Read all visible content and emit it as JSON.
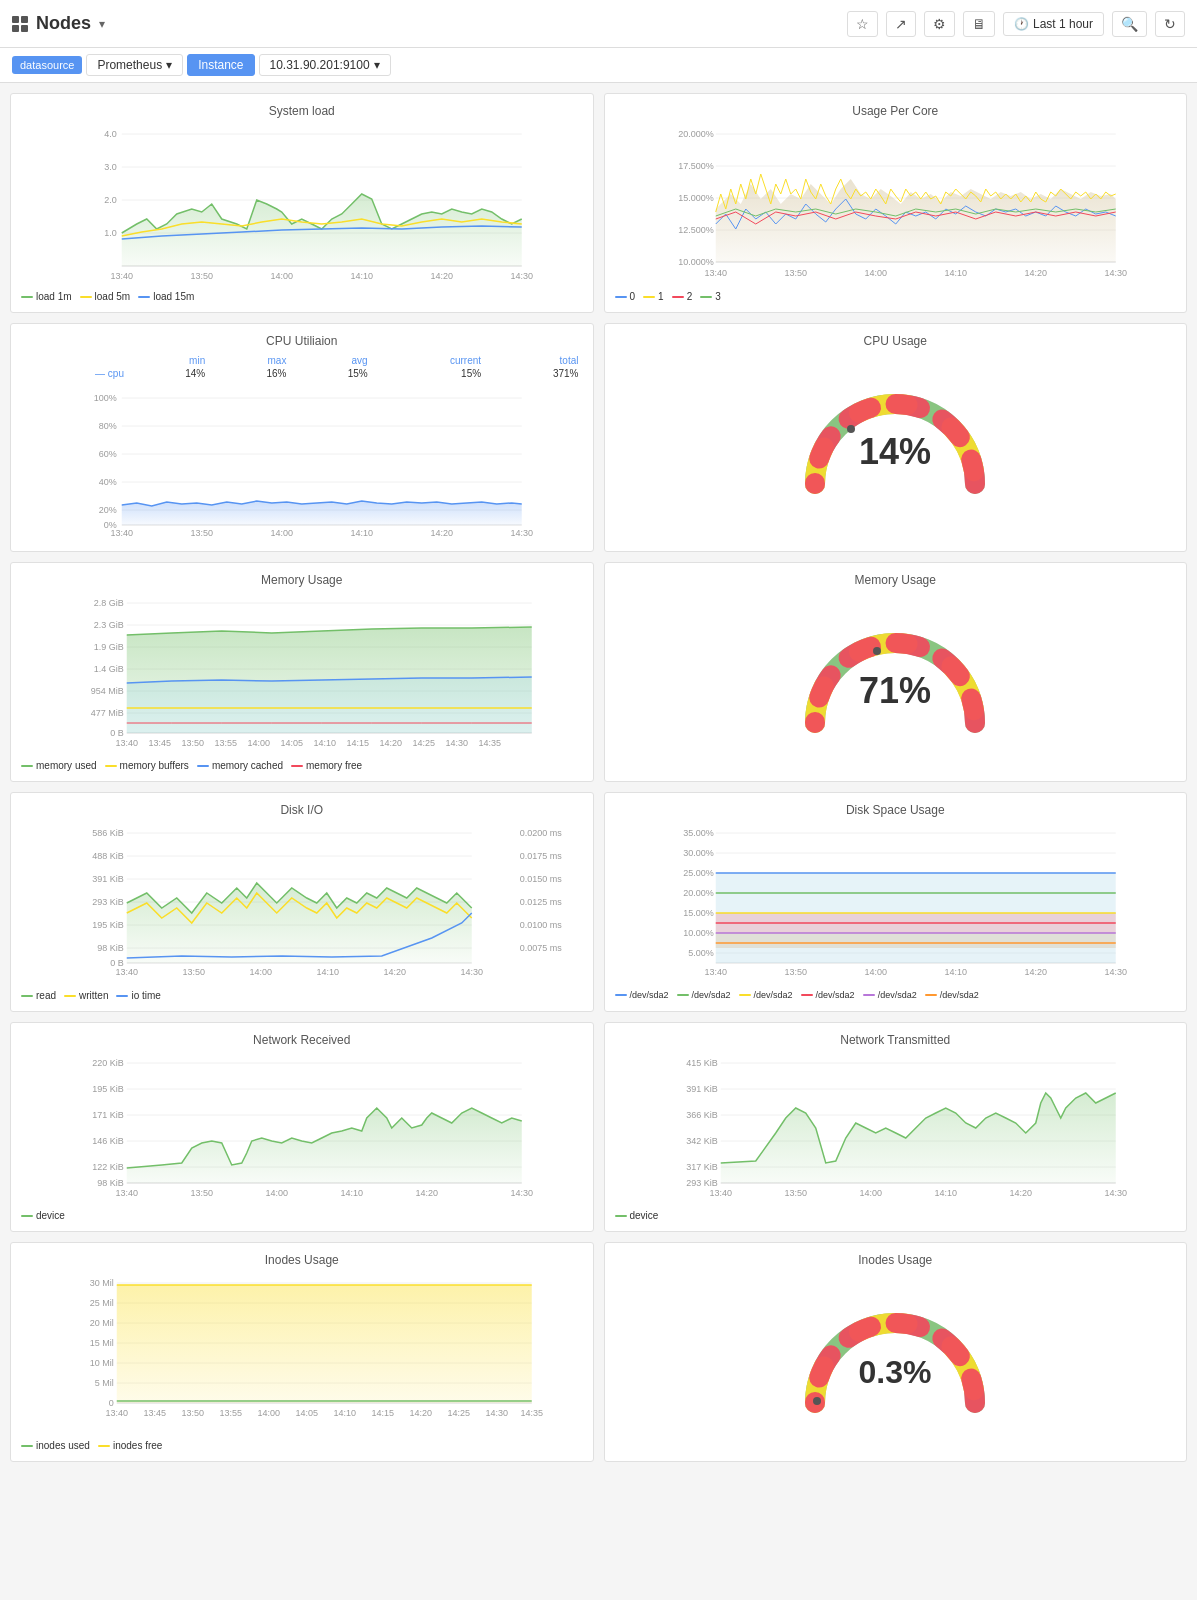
{
  "topbar": {
    "title": "Nodes",
    "time_label": "Last 1 hour",
    "icons": [
      "star",
      "share",
      "settings",
      "monitor",
      "clock",
      "search",
      "refresh"
    ]
  },
  "navbar": {
    "datasource": "datasource",
    "prometheus": "Prometheus",
    "instance_label": "Instance",
    "instance_value": "10.31.90.201:9100"
  },
  "panels": {
    "system_load": {
      "title": "System load",
      "y_labels": [
        "4.0",
        "3.0",
        "2.0",
        "1.0"
      ],
      "x_labels": [
        "13:40",
        "13:50",
        "14:00",
        "14:10",
        "14:20",
        "14:30"
      ],
      "legend": [
        {
          "label": "load 1m",
          "color": "#73BF69"
        },
        {
          "label": "load 5m",
          "color": "#FADE2A"
        },
        {
          "label": "load 15m",
          "color": "#5794F2"
        }
      ]
    },
    "usage_per_core": {
      "title": "Usage Per Core",
      "y_labels": [
        "20.000%",
        "17.500%",
        "15.000%",
        "12.500%",
        "10.000%"
      ],
      "x_labels": [
        "13:40",
        "13:50",
        "14:00",
        "14:10",
        "14:20",
        "14:30"
      ],
      "legend": [
        {
          "label": "0",
          "color": "#5794F2"
        },
        {
          "label": "1",
          "color": "#FADE2A"
        },
        {
          "label": "2",
          "color": "#F2495C"
        },
        {
          "label": "3",
          "color": "#73BF69"
        }
      ]
    },
    "cpu_utilization": {
      "title": "CPU Utiliaion",
      "y_labels": [
        "100%",
        "80%",
        "60%",
        "40%",
        "20%",
        "0%"
      ],
      "x_labels": [
        "13:40",
        "13:50",
        "14:00",
        "14:10",
        "14:20",
        "14:30"
      ],
      "table": {
        "headers": [
          "",
          "min",
          "max",
          "avg",
          "current",
          "total"
        ],
        "rows": [
          {
            "name": "cpu",
            "color": "#5794F2",
            "min": "14%",
            "max": "16%",
            "avg": "15%",
            "current": "15%",
            "total": "371%"
          }
        ]
      }
    },
    "cpu_usage_gauge": {
      "title": "CPU Usage",
      "value": "14%",
      "percentage": 14,
      "color": "#73BF69"
    },
    "memory_usage_chart": {
      "title": "Memory Usage",
      "y_labels": [
        "2.8 GiB",
        "2.3 GiB",
        "1.9 GiB",
        "1.4 GiB",
        "954 MiB",
        "477 MiB",
        "0 B"
      ],
      "x_labels": [
        "13:40",
        "13:45",
        "13:50",
        "13:55",
        "14:00",
        "14:05",
        "14:10",
        "14:15",
        "14:20",
        "14:25",
        "14:30",
        "14:35"
      ],
      "legend": [
        {
          "label": "memory used",
          "color": "#73BF69"
        },
        {
          "label": "memory buffers",
          "color": "#FADE2A"
        },
        {
          "label": "memory cached",
          "color": "#5794F2"
        },
        {
          "label": "memory free",
          "color": "#F2495C"
        }
      ]
    },
    "memory_usage_gauge": {
      "title": "Memory Usage",
      "value": "71%",
      "percentage": 71,
      "color": "#73BF69"
    },
    "disk_io": {
      "title": "Disk I/O",
      "y_labels_left": [
        "586 KiB",
        "488 KiB",
        "391 KiB",
        "293 KiB",
        "195 KiB",
        "98 KiB",
        "0 B"
      ],
      "y_labels_right": [
        "0.0200 ms",
        "0.0175 ms",
        "0.0150 ms",
        "0.0125 ms",
        "0.0100 ms",
        "0.0075 ms"
      ],
      "x_labels": [
        "13:40",
        "13:50",
        "14:00",
        "14:10",
        "14:20",
        "14:30"
      ],
      "legend": [
        {
          "label": "read",
          "color": "#73BF69"
        },
        {
          "label": "written",
          "color": "#FADE2A"
        },
        {
          "label": "io time",
          "color": "#5794F2"
        }
      ]
    },
    "disk_space": {
      "title": "Disk Space Usage",
      "y_labels": [
        "35.00%",
        "30.00%",
        "25.00%",
        "20.00%",
        "15.00%",
        "10.00%",
        "5.00%"
      ],
      "x_labels": [
        "13:40",
        "13:50",
        "14:00",
        "14:10",
        "14:20",
        "14:30"
      ],
      "legend": [
        {
          "label": "/dev/sda2",
          "color": "#5794F2"
        },
        {
          "label": "/dev/sda2",
          "color": "#73BF69"
        },
        {
          "label": "/dev/sda2",
          "color": "#FADE2A"
        },
        {
          "label": "/dev/sda2",
          "color": "#F2495C"
        },
        {
          "label": "/dev/sda2",
          "color": "#B877D9"
        },
        {
          "label": "/dev/sda2",
          "color": "#FF9830"
        }
      ]
    },
    "network_received": {
      "title": "Network Received",
      "y_labels": [
        "220 KiB",
        "195 KiB",
        "171 KiB",
        "146 KiB",
        "122 KiB",
        "98 KiB"
      ],
      "x_labels": [
        "13:40",
        "13:50",
        "14:00",
        "14:10",
        "14:20",
        "14:30"
      ],
      "legend": [
        {
          "label": "device",
          "color": "#73BF69"
        }
      ]
    },
    "network_transmitted": {
      "title": "Network Transmitted",
      "y_labels": [
        "415 KiB",
        "391 KiB",
        "366 KiB",
        "342 KiB",
        "317 KiB",
        "293 KiB"
      ],
      "x_labels": [
        "13:40",
        "13:50",
        "14:00",
        "14:10",
        "14:20",
        "14:30"
      ],
      "legend": [
        {
          "label": "device",
          "color": "#73BF69"
        }
      ]
    },
    "inodes_usage_chart": {
      "title": "Inodes Usage",
      "y_labels": [
        "30 Mil",
        "25 Mil",
        "20 Mil",
        "15 Mil",
        "10 Mil",
        "5 Mil",
        "0"
      ],
      "x_labels": [
        "13:40",
        "13:45",
        "13:50",
        "13:55",
        "14:00",
        "14:05",
        "14:10",
        "14:15",
        "14:20",
        "14:25",
        "14:30",
        "14:35"
      ],
      "legend": [
        {
          "label": "inodes used",
          "color": "#73BF69"
        },
        {
          "label": "inodes free",
          "color": "#FADE2A"
        }
      ]
    },
    "inodes_usage_gauge": {
      "title": "Inodes Usage",
      "value": "0.3%",
      "percentage": 0.3,
      "color": "#73BF69"
    }
  }
}
